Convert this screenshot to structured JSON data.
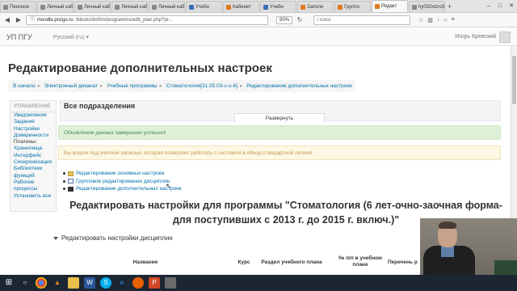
{
  "browser": {
    "tabs": [
      {
        "label": "Пенсион",
        "icon": "grey"
      },
      {
        "label": "Личный каб",
        "icon": "grey"
      },
      {
        "label": "Личный каб",
        "icon": "grey"
      },
      {
        "label": "Личный каб",
        "icon": "grey"
      },
      {
        "label": "Личный каб",
        "icon": "grey"
      },
      {
        "label": "Учебн",
        "icon": "blue"
      },
      {
        "label": "Кабинет",
        "icon": "orange"
      },
      {
        "label": "Учебн",
        "icon": "blue"
      },
      {
        "label": "Заполн",
        "icon": "orange"
      },
      {
        "label": "Группо",
        "icon": "orange"
      },
      {
        "label": "Редакт",
        "icon": "orange",
        "active": true
      },
      {
        "label": "hy032xtzrcth",
        "icon": "grey"
      }
    ],
    "url_host": "moodle.pnzgu.ru",
    "url_path": "/blocks/dof/im/programms/edit_plan.php?pr...",
    "zoom": "90%",
    "search_placeholder": "Поиск"
  },
  "header": {
    "brand": "УП ПГУ",
    "language": "Русский (ru) ▾",
    "user_name": "Игорь Кревский"
  },
  "page": {
    "title": "Редактирование дополнительных настроек",
    "breadcrumbs": [
      "В начало",
      "Электронный деканат",
      "Учебные программы",
      "Стоматология[31.05.03-с-о-6]",
      "Редактирование дополнительных настроек"
    ]
  },
  "sidebar": {
    "heading": "УПРАВЛЕНИЕ",
    "items": [
      "Уведомления",
      "Задания",
      "Настройки",
      "Доверенности",
      "Платины:",
      "Хранилища",
      "Интерфейс",
      "Синхронизация",
      "Библиотеки",
      "функций",
      "Рабочие",
      "процессы",
      "Установить все"
    ]
  },
  "main": {
    "region_title": "Все подразделения",
    "expand_label": "Развернуть",
    "success_message": "Обновление данных завершено успешно!",
    "warning_message": "Вы вошли под учетной записью, которая позволяет работать с системой в обход стандартной логики!",
    "links": [
      {
        "label": "Редактирование основных настроек",
        "icon": "folder"
      },
      {
        "label": "Групповое редактирование дисциплин",
        "icon": "table"
      },
      {
        "label": "Редактирование дополнительных настроек",
        "icon": "gear"
      }
    ],
    "big_heading": "Редактировать настройки для программы \"Стоматология (6 лет-очно-заочная форма-для поступивших с 2013 г. до 2015 г. включ.)\"",
    "section_title": "Редактировать настройки дисциплин",
    "table_headers": [
      "Название",
      "Курс",
      "Раздел учебного плана",
      "№ п/п в учебном плане",
      "Перечень р"
    ]
  },
  "taskbar": {
    "icons": [
      "windows-start",
      "search",
      "chrome",
      "vlc",
      "file-explorer",
      "word",
      "skype",
      "edge",
      "firefox",
      "powerpoint",
      "other"
    ]
  }
}
